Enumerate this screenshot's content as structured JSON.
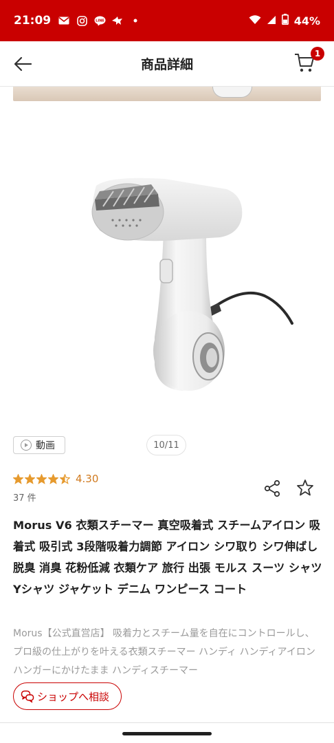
{
  "status_bar": {
    "time": "21:09",
    "battery": "44%",
    "icons": [
      "gmail-icon",
      "instagram-icon",
      "line-icon",
      "bird-app-icon",
      "dot-icon",
      "wifi-icon",
      "signal-icon",
      "battery-icon"
    ]
  },
  "header": {
    "title": "商品詳細",
    "cart_badge": "1"
  },
  "gallery": {
    "video_label": "動画",
    "counter": "10/11"
  },
  "rating": {
    "value": "4.30",
    "stars": 4.3,
    "count_label": "37 件"
  },
  "product": {
    "title": "Morus V6 衣類スチーマー 真空吸着式 スチームアイロン 吸着式 吸引式 3段階吸着力調節 アイロン シワ取り シワ伸ばし 脱臭 消臭 花粉低減 衣類ケア 旅行 出張 モルス スーツ シャツ Yシャツ ジャケット デニム ワンピース コート",
    "description": "Morus【公式直営店】 吸着力とスチーム量を自在にコントロールし、プロ級の仕上がりを叶える衣類スチーマー ハンディ ハンディアイロン ハンガーにかけたまま ハンディスチーマー"
  },
  "actions": {
    "consult_label": "ショップへ相談"
  },
  "colors": {
    "brand_red": "#c90000",
    "star_orange": "#e69a2e",
    "rating_text": "#d07a1f"
  }
}
